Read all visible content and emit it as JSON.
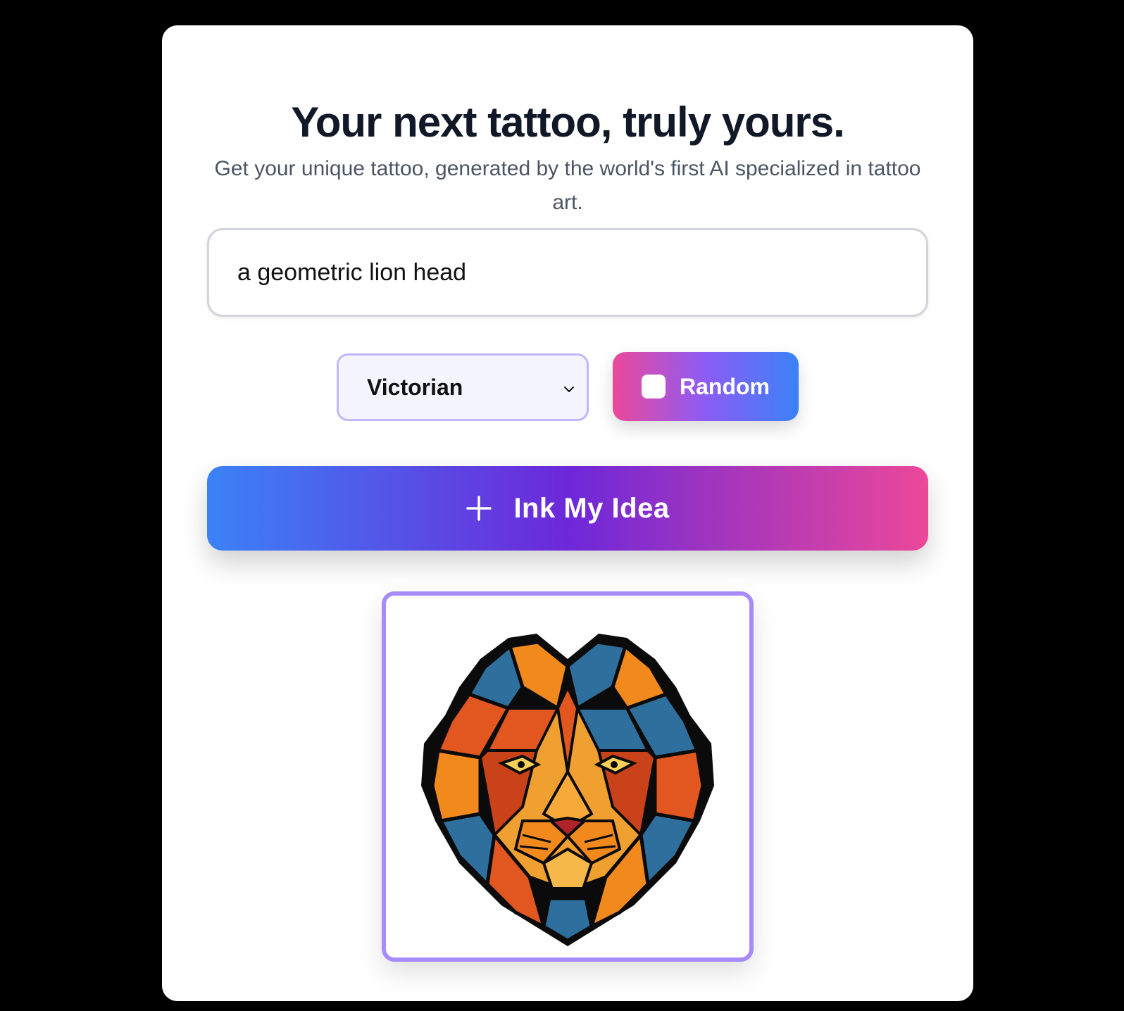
{
  "header": {
    "title": "Your next tattoo, truly yours.",
    "subtitle": "Get your unique tattoo, generated by the world's first AI specialized in tattoo art."
  },
  "prompt": {
    "value": "a geometric lion head"
  },
  "style_select": {
    "selected": "Victorian",
    "icon": "chevron-down-icon"
  },
  "random_button": {
    "label": "Random",
    "icon": "square-icon",
    "gradient": [
      "#ec4899",
      "#8b5cf6",
      "#3b82f6"
    ]
  },
  "generate_button": {
    "label": "Ink My Idea",
    "icon": "plus-icon",
    "gradient": [
      "#3b82f6",
      "#6d28d9",
      "#ec4899"
    ]
  },
  "result": {
    "image": "geometric-lion-head-tattoo",
    "border_color": "#a78bfa"
  },
  "colors": {
    "background": "#000000",
    "card": "#ffffff",
    "title": "#111827",
    "subtitle": "#4b5563"
  }
}
